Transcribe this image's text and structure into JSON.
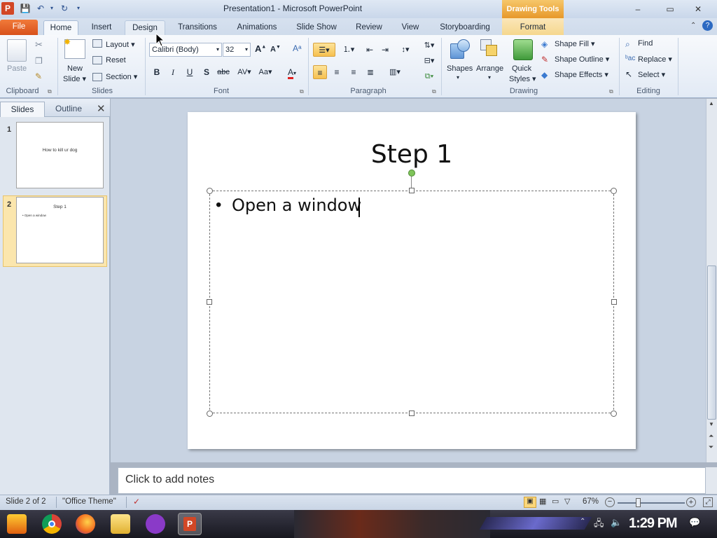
{
  "window": {
    "title": "Presentation1 - Microsoft PowerPoint",
    "context_header": "Drawing Tools",
    "controls": [
      "–",
      "▭",
      "✕"
    ]
  },
  "tabs": [
    "File",
    "Home",
    "Insert",
    "Design",
    "Transitions",
    "Animations",
    "Slide Show",
    "Review",
    "View",
    "Storyboarding",
    "Format"
  ],
  "ribbon": {
    "clipboard": {
      "label": "Clipboard",
      "paste": "Paste"
    },
    "slides": {
      "label": "Slides",
      "new_slide_1": "New",
      "new_slide_2": "Slide ▾",
      "layout": "Layout ▾",
      "reset": "Reset",
      "section": "Section ▾"
    },
    "font": {
      "label": "Font",
      "family": "Calibri (Body)",
      "size": "32"
    },
    "paragraph": {
      "label": "Paragraph"
    },
    "drawing": {
      "label": "Drawing",
      "shapes": "Shapes",
      "arrange": "Arrange",
      "quick_styles_1": "Quick",
      "quick_styles_2": "Styles ▾",
      "shape_fill": "Shape Fill ▾",
      "shape_outline": "Shape Outline ▾",
      "shape_effects": "Shape Effects ▾"
    },
    "editing": {
      "label": "Editing",
      "find": "Find",
      "replace": "Replace ▾",
      "select": "Select ▾"
    }
  },
  "left_pane": {
    "tabs": [
      "Slides",
      "Outline"
    ],
    "slides": [
      {
        "number": "1",
        "title": "How to kill ur dog"
      },
      {
        "number": "2",
        "title": "Step 1",
        "bullet": "• Open a window"
      }
    ]
  },
  "slide": {
    "title": "Step 1",
    "bullet": "•",
    "body": "Open a window"
  },
  "notes": {
    "placeholder": "Click to add notes"
  },
  "status": {
    "slide_info": "Slide 2 of 2",
    "theme": "\"Office Theme\"",
    "zoom": "67%"
  },
  "taskbar": {
    "clock": "1:29 PM"
  },
  "colors": {
    "file_tab": "#d8511b",
    "context_tab": "#e7982a",
    "selected_thumb": "#fbe6ad",
    "accent_blue": "#2a4f8e"
  }
}
